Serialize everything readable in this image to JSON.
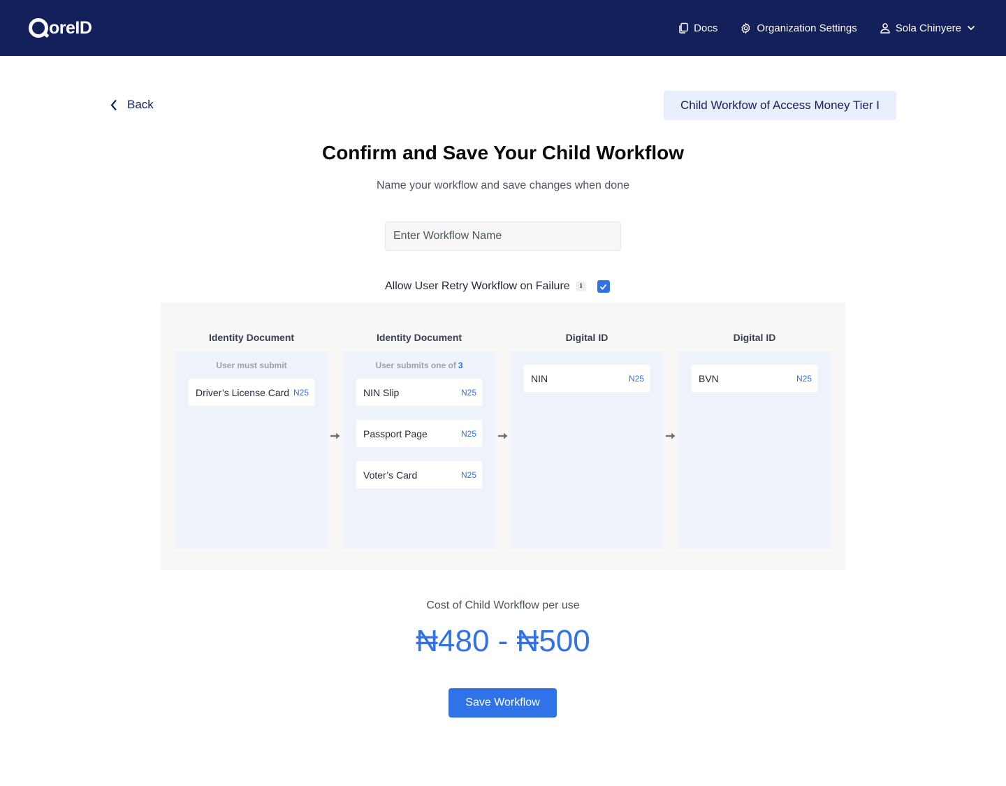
{
  "header": {
    "logo_text": "oreID",
    "nav": {
      "docs": "Docs",
      "org_settings": "Organization Settings",
      "user": "Sola Chinyere"
    }
  },
  "back_label": "Back",
  "workflow_badge": "Child Workfow of Access Money Tier I",
  "title": "Confirm and Save Your Child Workflow",
  "subtitle": "Name your workflow and save changes when done",
  "workflow_name": {
    "value": "",
    "placeholder": "Enter Workflow Name"
  },
  "retry": {
    "label": "Allow User Retry Workflow on Failure",
    "info": "i",
    "checked": true
  },
  "columns": [
    {
      "heading": "Identity Document",
      "note": "User must submit",
      "count": "",
      "items": [
        {
          "label": "Driver’s License Card",
          "price": "N25"
        }
      ]
    },
    {
      "heading": "Identity Document",
      "note": "User submits one of",
      "count": "3",
      "items": [
        {
          "label": "NIN Slip",
          "price": "N25"
        },
        {
          "label": "Passport Page",
          "price": "N25"
        },
        {
          "label": "Voter’s Card",
          "price": "N25"
        }
      ]
    },
    {
      "heading": "Digital ID",
      "note": "",
      "count": "",
      "items": [
        {
          "label": "NIN",
          "price": "N25"
        }
      ]
    },
    {
      "heading": "Digital ID",
      "note": "",
      "count": "",
      "items": [
        {
          "label": "BVN",
          "price": "N25"
        }
      ]
    }
  ],
  "cost": {
    "label": "Cost of Child Workflow per use",
    "value": "₦480 - ₦500"
  },
  "save_label": "Save Workflow",
  "colors": {
    "header_bg": "#14205a",
    "accent": "#2f73e6",
    "badge_bg": "#e8eefb",
    "column_bg": "#eef2f9"
  }
}
